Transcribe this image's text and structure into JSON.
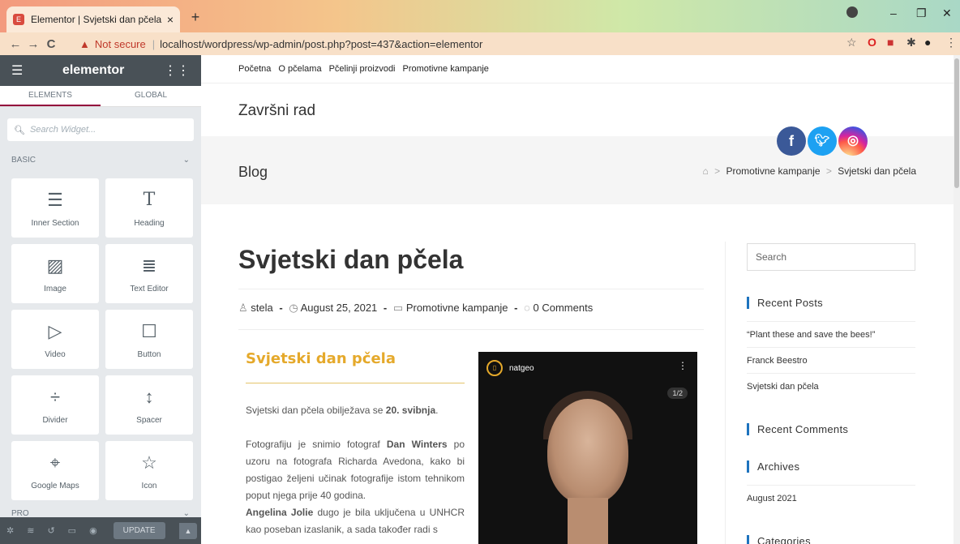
{
  "browser": {
    "tab_title": "Elementor | Svjetski dan pčela",
    "tab_close": "×",
    "new_tab": "+",
    "not_secure": "Not secure",
    "url": "localhost/wordpress/wp-admin/post.php?post=437&action=elementor",
    "back": "←",
    "forward": "→",
    "reload": "C"
  },
  "sidebar": {
    "logo": "elementor",
    "tabs": [
      "ELEMENTS",
      "GLOBAL"
    ],
    "search_placeholder": "Search Widget...",
    "section_basic": "BASIC",
    "section_pro": "PRO",
    "widgets": [
      {
        "label": "Inner Section",
        "icon": "inner-section-icon",
        "glyph": "☰"
      },
      {
        "label": "Heading",
        "icon": "heading-icon",
        "glyph": "T"
      },
      {
        "label": "Image",
        "icon": "image-icon",
        "glyph": "▨"
      },
      {
        "label": "Text Editor",
        "icon": "text-editor-icon",
        "glyph": "≣"
      },
      {
        "label": "Video",
        "icon": "video-icon",
        "glyph": "▷"
      },
      {
        "label": "Button",
        "icon": "button-icon",
        "glyph": "☐"
      },
      {
        "label": "Divider",
        "icon": "divider-icon",
        "glyph": "÷"
      },
      {
        "label": "Spacer",
        "icon": "spacer-icon",
        "glyph": "↕"
      },
      {
        "label": "Google Maps",
        "icon": "google-maps-icon",
        "glyph": "⌖"
      },
      {
        "label": "Icon",
        "icon": "star-icon",
        "glyph": "☆"
      }
    ],
    "update_label": "UPDATE"
  },
  "site": {
    "nav": [
      "Početna",
      "O pčelama",
      "Pčelinji proizvodi",
      "Promotivne kampanje"
    ],
    "title": "Završni rad",
    "page_heading": "Blog",
    "breadcrumb": [
      "Promotivne kampanje",
      "Svjetski dan pčela"
    ],
    "breadcrumb_sep": ">"
  },
  "post": {
    "title": "Svjetski dan pčela",
    "author": "stela",
    "date": "August 25, 2021",
    "category": "Promotivne kampanje",
    "comments": "0 Comments",
    "meta_sep": "-",
    "inner_title": "Svjetski dan pčela",
    "p1_pre": "Svjetski dan pčela obilježava se ",
    "p1_bold": "20. svibnja",
    "p1_post": ".",
    "p2_pre": "Fotografiju je snimio fotograf ",
    "p2_bold": "Dan Winters",
    "p2_post": " po uzoru na fotografa Richarda Avedona, kako bi postigao željeni učinak fotografije istom tehnikom poput njega prije 40 godina.",
    "p3_bold": "Angelina Jolie",
    "p3_post": " dugo je bila uključena u UNHCR kao poseban izaslanik, a sada također radi s",
    "insta_account": "natgeo",
    "insta_count": "1/2"
  },
  "right_sidebar": {
    "search_placeholder": "Search",
    "recent_posts_title": "Recent Posts",
    "recent_posts": [
      "“Plant these and save the bees!”",
      "Franck Beestro",
      "Svjetski dan pčela"
    ],
    "recent_comments_title": "Recent Comments",
    "archives_title": "Archives",
    "archives": [
      "August 2021"
    ],
    "categories_title": "Categories"
  },
  "colors": {
    "elementor_dark": "#495157",
    "accent_gold": "#e5a92b",
    "facebook": "#3b5998",
    "twitter": "#1da1f2",
    "instagram": "#c13584"
  }
}
